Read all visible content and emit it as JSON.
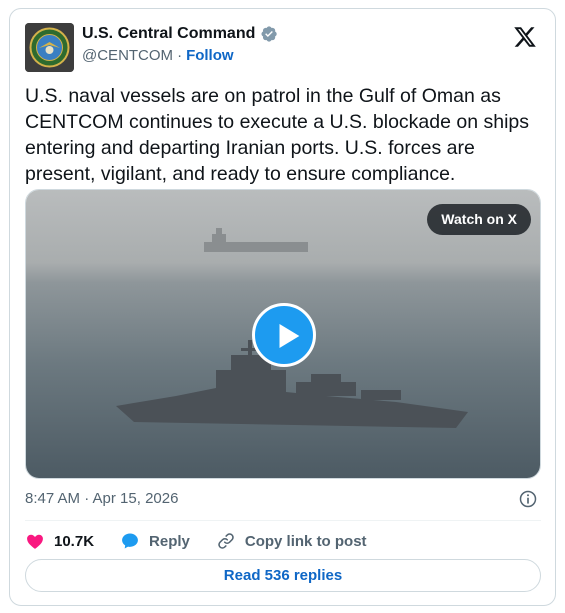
{
  "author": {
    "display_name": "U.S. Central Command",
    "handle": "@CENTCOM",
    "separator": "·",
    "follow_label": "Follow"
  },
  "post": {
    "text": "U.S. naval vessels are on patrol in the Gulf of Oman as CENTCOM continues to execute a U.S. blockade on ships entering and departing Iranian ports. U.S. forces are present, vigilant, and ready to ensure compliance.",
    "timestamp": "8:47 AM · Apr 15, 2026"
  },
  "media": {
    "watch_label": "Watch on X"
  },
  "actions": {
    "likes": "10.7K",
    "reply_label": "Reply",
    "copy_link_label": "Copy link to post"
  },
  "footer": {
    "read_replies_label": "Read 536 replies"
  },
  "colors": {
    "accent": "#1d9bf0",
    "link": "#0f67c6",
    "like": "#f91880",
    "muted": "#536471"
  }
}
